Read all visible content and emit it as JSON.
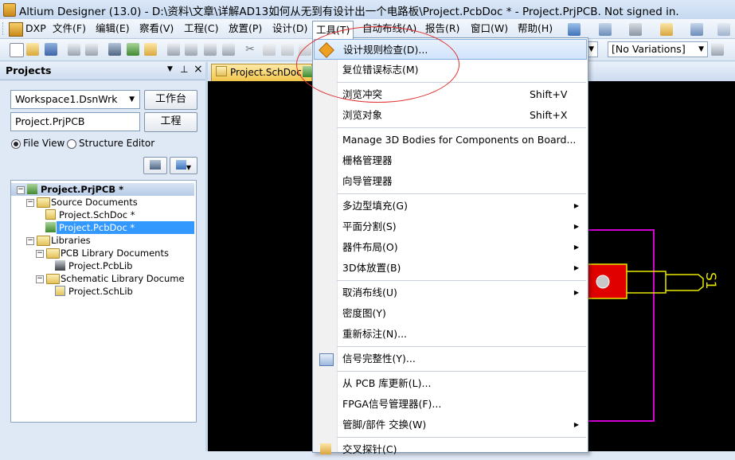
{
  "window": {
    "title": "Altium Designer (13.0) - D:\\资料\\文章\\详解AD13如何从无到有设计出一个电路板\\Project.PcbDoc * - Project.PrjPCB. Not signed in."
  },
  "menubar": {
    "items": [
      "DXP",
      "文件(F)",
      "编辑(E)",
      "察看(V)",
      "工程(C)",
      "放置(P)",
      "设计(D)",
      "工具(T)",
      "自动布线(A)",
      "报告(R)",
      "窗口(W)",
      "帮助(H)"
    ]
  },
  "toolbar": {
    "variations": "[No Variations]"
  },
  "projects_panel": {
    "title": "Projects",
    "workspace_value": "Workspace1.DsnWrk",
    "workspace_button": "工作台",
    "project_value": "Project.PrjPCB",
    "project_button": "工程",
    "view_file": "File View",
    "view_structure": "Structure Editor",
    "tree": [
      "Project.PrjPCB *",
      "Source Documents",
      "Project.SchDoc *",
      "Project.PcbDoc *",
      "Libraries",
      "PCB Library Documents",
      "Project.PcbLib",
      "Schematic Library Docume",
      "Project.SchLib"
    ]
  },
  "document": {
    "tab_label": "Project.SchDoc *",
    "component_label": "S1"
  },
  "tools_menu": {
    "items": [
      {
        "label": "设计规则检查(D)..."
      },
      {
        "label": "复位错误标志(M)"
      },
      {
        "label": "浏览冲突",
        "shortcut": "Shift+V"
      },
      {
        "label": "浏览对象",
        "shortcut": "Shift+X"
      },
      {
        "label": "Manage 3D Bodies for Components on Board..."
      },
      {
        "label": "栅格管理器"
      },
      {
        "label": "向导管理器"
      },
      {
        "label": "多边型填充(G)"
      },
      {
        "label": "平面分割(S)"
      },
      {
        "label": "器件布局(O)"
      },
      {
        "label": "3D体放置(B)"
      },
      {
        "label": "取消布线(U)"
      },
      {
        "label": "密度图(Y)"
      },
      {
        "label": "重新标注(N)..."
      },
      {
        "label": "信号完整性(Y)..."
      },
      {
        "label": "从 PCB 库更新(L)..."
      },
      {
        "label": "FPGA信号管理器(F)..."
      },
      {
        "label": "管脚/部件 交换(W)"
      },
      {
        "label": "交叉探针(C)"
      }
    ]
  },
  "colors": {
    "accent": "#3399ff",
    "board_outline": "#d400d4",
    "pad_red": "#e00000",
    "silkscreen": "#e8e800",
    "annotation": "#e03030"
  }
}
